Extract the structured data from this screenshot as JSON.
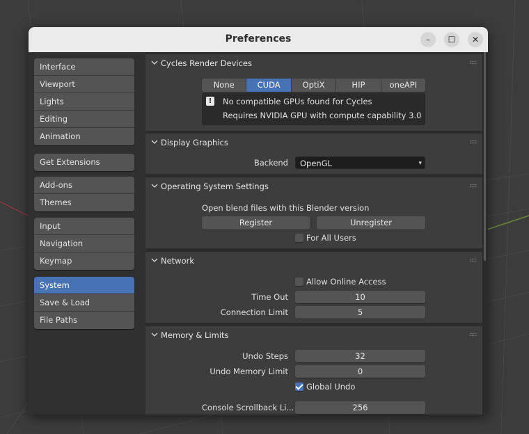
{
  "window": {
    "title": "Preferences"
  },
  "window_controls": {
    "minimize": "–",
    "maximize": "☐",
    "close": "✕"
  },
  "sidebar": {
    "groups": [
      [
        "Interface",
        "Viewport",
        "Lights",
        "Editing",
        "Animation"
      ],
      [
        "Get Extensions"
      ],
      [
        "Add-ons",
        "Themes"
      ],
      [
        "Input",
        "Navigation",
        "Keymap"
      ],
      [
        "System",
        "Save & Load",
        "File Paths"
      ]
    ],
    "active": "System",
    "menu_icon": "hamburger-menu-icon"
  },
  "cycles": {
    "header": "Cycles Render Devices",
    "options": [
      "None",
      "CUDA",
      "OptiX",
      "HIP",
      "oneAPI"
    ],
    "selected": "CUDA",
    "info_line1": "No compatible GPUs found for Cycles",
    "info_line2": "Requires NVIDIA GPU with compute capability 3.0",
    "info_icon": "!"
  },
  "display_graphics": {
    "header": "Display Graphics",
    "backend_label": "Backend",
    "backend_value": "OpenGL"
  },
  "os_settings": {
    "header": "Operating System Settings",
    "description": "Open blend files with this Blender version",
    "register": "Register",
    "unregister": "Unregister",
    "for_all_users": "For All Users",
    "for_all_users_checked": false
  },
  "network": {
    "header": "Network",
    "allow_online": "Allow Online Access",
    "allow_online_checked": false,
    "timeout_label": "Time Out",
    "timeout_value": "10",
    "connection_limit_label": "Connection Limit",
    "connection_limit_value": "5"
  },
  "memory": {
    "header": "Memory & Limits",
    "undo_steps_label": "Undo Steps",
    "undo_steps_value": "32",
    "undo_memory_label": "Undo Memory Limit",
    "undo_memory_value": "0",
    "global_undo": "Global Undo",
    "global_undo_checked": true,
    "console_label": "Console Scrollback Li...",
    "console_value": "256"
  },
  "colors": {
    "accent": "#4772b3",
    "panel": "#3d3d3d",
    "button": "#545454"
  }
}
